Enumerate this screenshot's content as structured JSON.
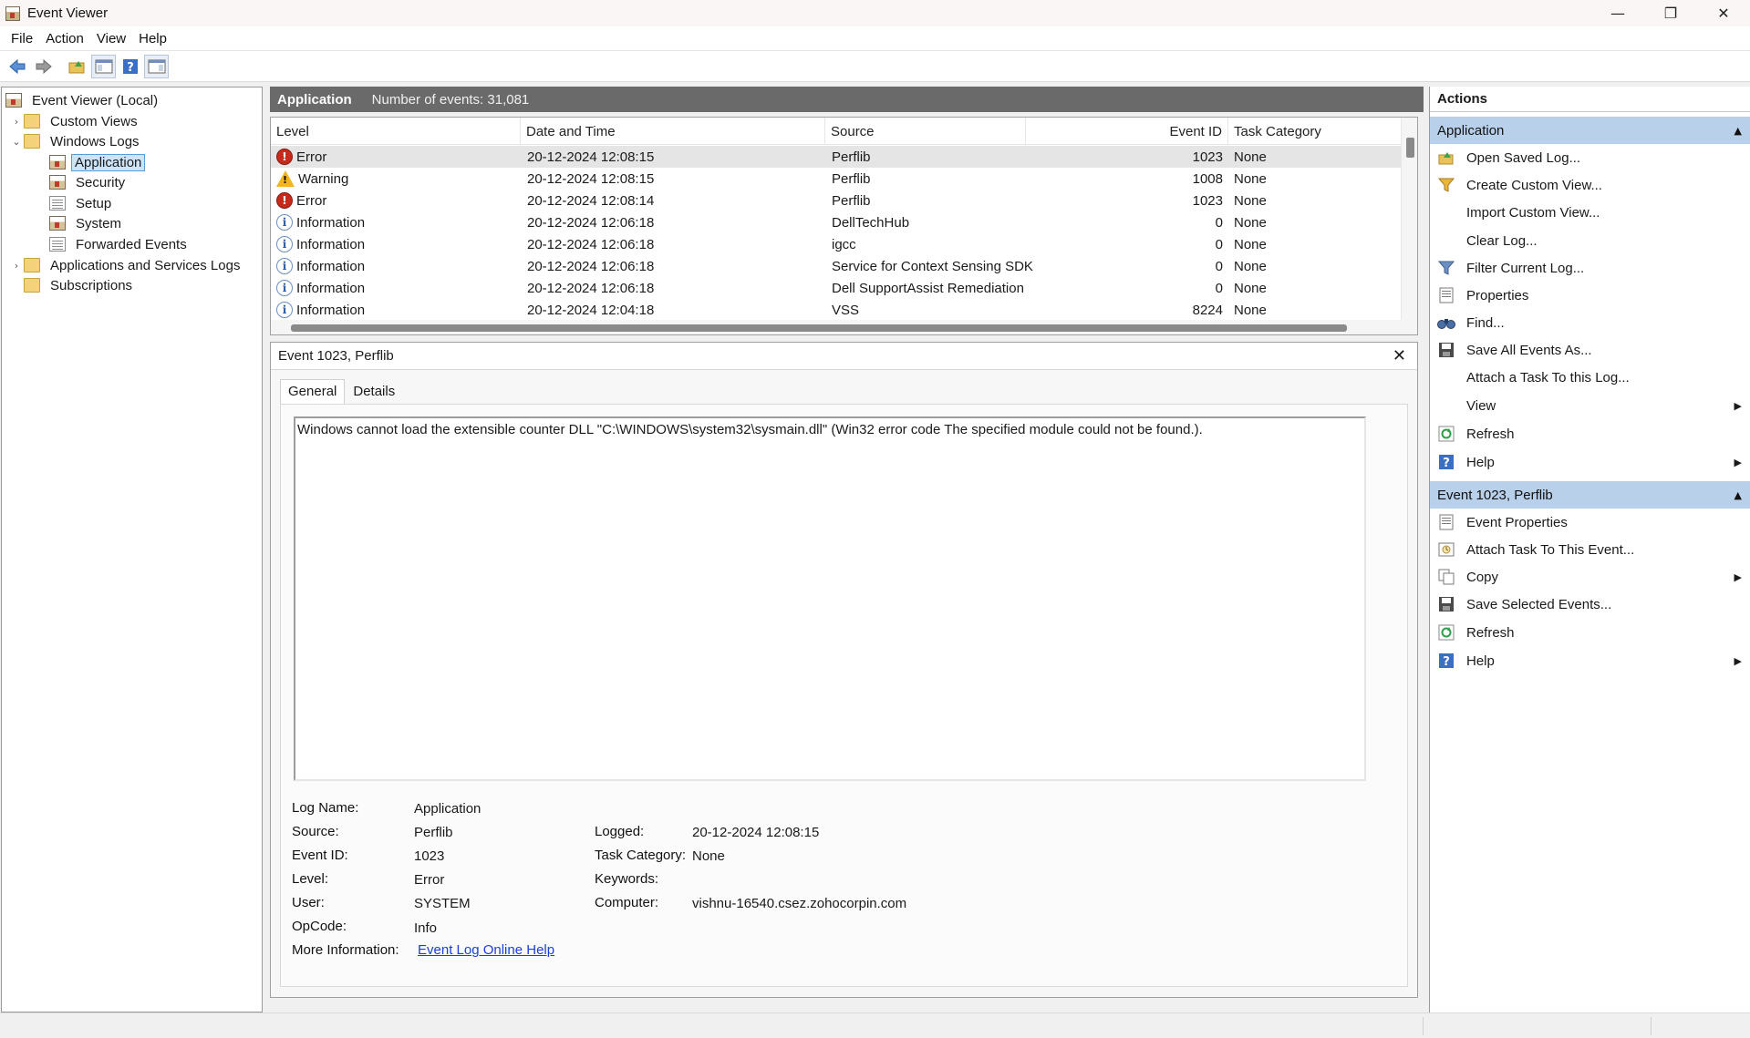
{
  "window": {
    "title": "Event Viewer",
    "minimize": "—",
    "restore": "❐",
    "close": "✕"
  },
  "menu": [
    {
      "label": "File"
    },
    {
      "label": "Action"
    },
    {
      "label": "View"
    },
    {
      "label": "Help"
    }
  ],
  "toolbar": {
    "buttons": [
      "back-arrow-icon",
      "forward-arrow-icon",
      "open-folder-icon",
      "show-hide-tree-icon",
      "help-icon",
      "show-hide-action-pane-icon"
    ]
  },
  "tree": {
    "root": "Event Viewer (Local)",
    "custom_views": "Custom Views",
    "windows_logs": "Windows Logs",
    "application": "Application",
    "security": "Security",
    "setup": "Setup",
    "system": "System",
    "forwarded": "Forwarded Events",
    "app_services": "Applications and Services Logs",
    "subscriptions": "Subscriptions"
  },
  "events": {
    "title": "Application",
    "count_text": "Number of events: 31,081",
    "columns": {
      "level": "Level",
      "datetime": "Date and Time",
      "source": "Source",
      "event_id": "Event ID",
      "task_category": "Task Category"
    },
    "rows": [
      {
        "level": "Error",
        "icon": "error-icon",
        "datetime": "20-12-2024 12:08:15",
        "source": "Perflib",
        "event_id": "1023",
        "task_category": "None"
      },
      {
        "level": "Warning",
        "icon": "warning-icon",
        "datetime": "20-12-2024 12:08:15",
        "source": "Perflib",
        "event_id": "1008",
        "task_category": "None"
      },
      {
        "level": "Error",
        "icon": "error-icon",
        "datetime": "20-12-2024 12:08:14",
        "source": "Perflib",
        "event_id": "1023",
        "task_category": "None"
      },
      {
        "level": "Information",
        "icon": "info-icon",
        "datetime": "20-12-2024 12:06:18",
        "source": "DellTechHub",
        "event_id": "0",
        "task_category": "None"
      },
      {
        "level": "Information",
        "icon": "info-icon",
        "datetime": "20-12-2024 12:06:18",
        "source": "igcc",
        "event_id": "0",
        "task_category": "None"
      },
      {
        "level": "Information",
        "icon": "info-icon",
        "datetime": "20-12-2024 12:06:18",
        "source": "Service for Context Sensing SDK",
        "event_id": "0",
        "task_category": "None"
      },
      {
        "level": "Information",
        "icon": "info-icon",
        "datetime": "20-12-2024 12:06:18",
        "source": "Dell SupportAssist Remediation",
        "event_id": "0",
        "task_category": "None"
      },
      {
        "level": "Information",
        "icon": "info-icon",
        "datetime": "20-12-2024 12:04:18",
        "source": "VSS",
        "event_id": "8224",
        "task_category": "None"
      }
    ]
  },
  "detail": {
    "title": "Event 1023, Perflib",
    "close": "✕",
    "tabs": {
      "general": "General",
      "details": "Details"
    },
    "message": "Windows cannot load the extensible counter DLL \"C:\\WINDOWS\\system32\\sysmain.dll\" (Win32 error code The specified module could not be found.).",
    "labels": {
      "log_name": "Log Name:",
      "source": "Source:",
      "event_id": "Event ID:",
      "level": "Level:",
      "user": "User:",
      "opcode": "OpCode:",
      "more_info": "More Information:",
      "logged": "Logged:",
      "task_category": "Task Category:",
      "keywords": "Keywords:",
      "computer": "Computer:"
    },
    "values": {
      "log_name": "Application",
      "source": "Perflib",
      "event_id": "1023",
      "level": "Error",
      "user": "SYSTEM",
      "opcode": "Info",
      "more_info_link": "Event Log Online Help",
      "logged": "20-12-2024 12:08:15",
      "task_category": "None",
      "keywords": "",
      "computer": "vishnu-16540.csez.zohocorpin.com"
    }
  },
  "actions": {
    "title": "Actions",
    "section1": "Application",
    "section1_items": [
      {
        "label": "Open Saved Log...",
        "icon": "open-folder-icon"
      },
      {
        "label": "Create Custom View...",
        "icon": "filter-icon"
      },
      {
        "label": "Import Custom View...",
        "icon": ""
      },
      {
        "label": "Clear Log...",
        "icon": ""
      },
      {
        "label": "Filter Current Log...",
        "icon": "filter-icon"
      },
      {
        "label": "Properties",
        "icon": "properties-icon"
      },
      {
        "label": "Find...",
        "icon": "binoculars-icon"
      },
      {
        "label": "Save All Events As...",
        "icon": "save-icon"
      },
      {
        "label": "Attach a Task To this Log...",
        "icon": ""
      },
      {
        "label": "View",
        "icon": "",
        "submenu": true
      },
      {
        "label": "Refresh",
        "icon": "refresh-icon"
      },
      {
        "label": "Help",
        "icon": "help-icon",
        "submenu": true
      }
    ],
    "section2": "Event 1023, Perflib",
    "section2_items": [
      {
        "label": "Event Properties",
        "icon": "properties-icon"
      },
      {
        "label": "Attach Task To This Event...",
        "icon": "task-icon"
      },
      {
        "label": "Copy",
        "icon": "copy-icon",
        "submenu": true
      },
      {
        "label": "Save Selected Events...",
        "icon": "save-icon"
      },
      {
        "label": "Refresh",
        "icon": "refresh-icon"
      },
      {
        "label": "Help",
        "icon": "help-icon",
        "submenu": true
      }
    ]
  }
}
